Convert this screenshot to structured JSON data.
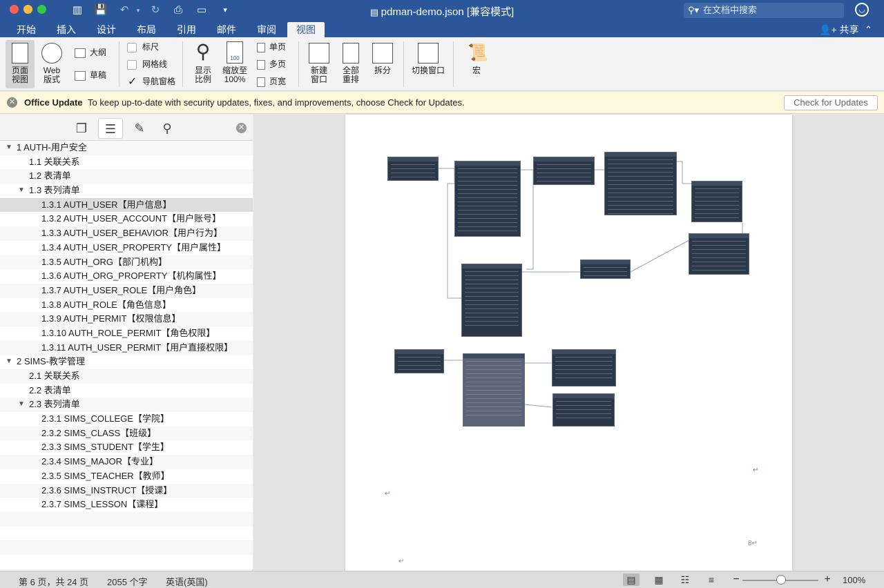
{
  "window": {
    "title": "pdman-demo.json [兼容模式]",
    "search_placeholder": "在文档中搜索"
  },
  "ribbon_tabs": [
    "开始",
    "插入",
    "设计",
    "布局",
    "引用",
    "邮件",
    "审阅",
    "视图"
  ],
  "active_tab": "视图",
  "share_label": "共享",
  "ribbon": {
    "page_view": "页面\n视图",
    "web_view": "Web\n版式",
    "outline": "大纲",
    "draft": "草稿",
    "ruler": "标尺",
    "gridlines": "网格线",
    "nav_pane": "导航窗格",
    "ruler_checked": false,
    "gridlines_checked": false,
    "nav_pane_checked": true,
    "zoom": "显示\n比例",
    "zoom100": "缩放至\n100%",
    "one_page": "单页",
    "multi_page": "多页",
    "page_width": "页宽",
    "new_window": "新建\n窗口",
    "arrange_all": "全部\n重排",
    "split": "拆分",
    "switch_window": "切换窗口",
    "macros": "宏"
  },
  "message_bar": {
    "title": "Office Update",
    "text": "To keep up-to-date with security updates, fixes, and improvements, choose Check for Updates.",
    "button": "Check for Updates"
  },
  "nav": {
    "items": [
      {
        "label": "1 AUTH-用户安全",
        "level": 0,
        "expanded": true
      },
      {
        "label": "1.1 关联关系",
        "level": 1
      },
      {
        "label": "1.2 表清单",
        "level": 1
      },
      {
        "label": "1.3 表列清单",
        "level": 1,
        "expanded": true
      },
      {
        "label": "1.3.1 AUTH_USER【用户信息】",
        "level": 2,
        "selected": true
      },
      {
        "label": "1.3.2 AUTH_USER_ACCOUNT【用户账号】",
        "level": 2
      },
      {
        "label": "1.3.3 AUTH_USER_BEHAVIOR【用户行为】",
        "level": 2
      },
      {
        "label": "1.3.4 AUTH_USER_PROPERTY【用户属性】",
        "level": 2
      },
      {
        "label": "1.3.5 AUTH_ORG【部门机构】",
        "level": 2
      },
      {
        "label": "1.3.6 AUTH_ORG_PROPERTY【机构属性】",
        "level": 2
      },
      {
        "label": "1.3.7 AUTH_USER_ROLE【用户角色】",
        "level": 2
      },
      {
        "label": "1.3.8 AUTH_ROLE【角色信息】",
        "level": 2
      },
      {
        "label": "1.3.9 AUTH_PERMIT【权限信息】",
        "level": 2
      },
      {
        "label": "1.3.10 AUTH_ROLE_PERMIT【角色权限】",
        "level": 2
      },
      {
        "label": "1.3.11 AUTH_USER_PERMIT【用户直接权限】",
        "level": 2
      },
      {
        "label": "2 SIMS-教学管理",
        "level": 0,
        "expanded": true
      },
      {
        "label": "2.1 关联关系",
        "level": 1
      },
      {
        "label": "2.2 表清单",
        "level": 1
      },
      {
        "label": "2.3 表列清单",
        "level": 1,
        "expanded": true
      },
      {
        "label": "2.3.1 SIMS_COLLEGE【学院】",
        "level": 2
      },
      {
        "label": "2.3.2 SIMS_CLASS【班级】",
        "level": 2
      },
      {
        "label": "2.3.3 SIMS_STUDENT【学生】",
        "level": 2
      },
      {
        "label": "2.3.4 SIMS_MAJOR【专业】",
        "level": 2
      },
      {
        "label": "2.3.5 SIMS_TEACHER【教师】",
        "level": 2
      },
      {
        "label": "2.3.6 SIMS_INSTRUCT【授课】",
        "level": 2
      },
      {
        "label": "2.3.7 SIMS_LESSON【课程】",
        "level": 2
      },
      {
        "label": "",
        "level": 0
      },
      {
        "label": "",
        "level": 0
      },
      {
        "label": "",
        "level": 0
      },
      {
        "label": "",
        "level": 0
      }
    ]
  },
  "document": {
    "page_number_mark": "8↵",
    "para_mark": "↵"
  },
  "status": {
    "page": "第 6 页，共 24 页",
    "words": "2055 个字",
    "language": "英语(英国)",
    "zoom": "100%"
  }
}
